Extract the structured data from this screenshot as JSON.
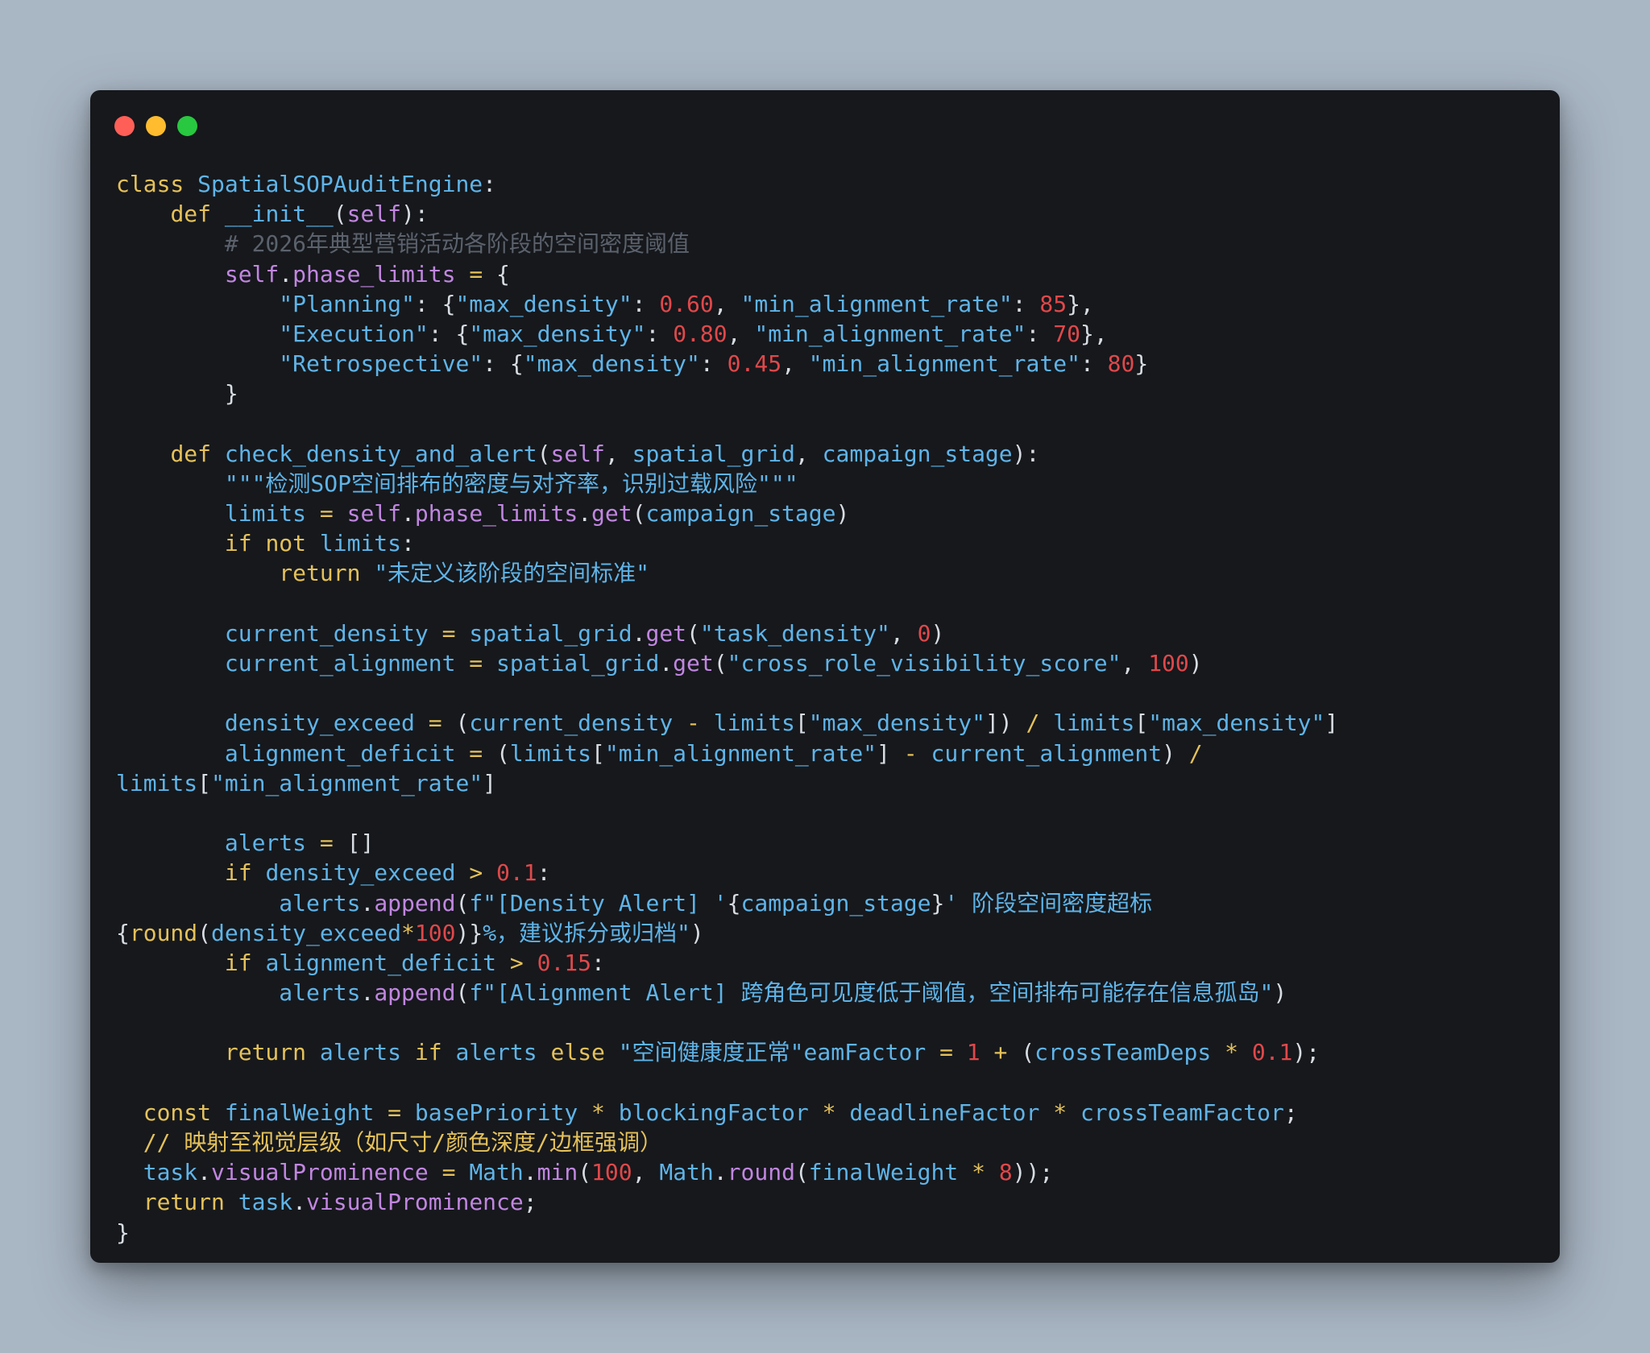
{
  "window": {
    "controls": [
      {
        "name": "close",
        "color": "#ff5f57"
      },
      {
        "name": "minimize",
        "color": "#febc2e"
      },
      {
        "name": "maximize",
        "color": "#28c840"
      }
    ]
  },
  "colors": {
    "background": "#a9b6c4",
    "editor_bg": "#16181c",
    "keyword": "#e5c15a",
    "identifier": "#5fb4e8",
    "self": "#c186e0",
    "number": "#e0484a",
    "comment": "#5b626c",
    "punctuation": "#d8dde3"
  },
  "code_lines": [
    [
      [
        "kw",
        "class"
      ],
      [
        "pun",
        " "
      ],
      [
        "cls",
        "SpatialSOPAuditEngine"
      ],
      [
        "pun",
        ":"
      ]
    ],
    [
      [
        "pun",
        "    "
      ],
      [
        "kw",
        "def"
      ],
      [
        "pun",
        " "
      ],
      [
        "fn",
        "__init__"
      ],
      [
        "pun",
        "("
      ],
      [
        "self",
        "self"
      ],
      [
        "pun",
        "):"
      ]
    ],
    [
      [
        "pun",
        "        "
      ],
      [
        "cm",
        "# 2026年典型营销活动各阶段的空间密度阈值"
      ]
    ],
    [
      [
        "pun",
        "        "
      ],
      [
        "self",
        "self"
      ],
      [
        "pun",
        "."
      ],
      [
        "attr",
        "phase_limits"
      ],
      [
        "pun",
        " "
      ],
      [
        "op",
        "="
      ],
      [
        "pun",
        " {"
      ]
    ],
    [
      [
        "pun",
        "            "
      ],
      [
        "str",
        "\"Planning\""
      ],
      [
        "pun",
        ": {"
      ],
      [
        "str",
        "\"max_density\""
      ],
      [
        "pun",
        ": "
      ],
      [
        "num",
        "0.60"
      ],
      [
        "pun",
        ", "
      ],
      [
        "str",
        "\"min_alignment_rate\""
      ],
      [
        "pun",
        ": "
      ],
      [
        "num",
        "85"
      ],
      [
        "pun",
        "},"
      ]
    ],
    [
      [
        "pun",
        "            "
      ],
      [
        "str",
        "\"Execution\""
      ],
      [
        "pun",
        ": {"
      ],
      [
        "str",
        "\"max_density\""
      ],
      [
        "pun",
        ": "
      ],
      [
        "num",
        "0.80"
      ],
      [
        "pun",
        ", "
      ],
      [
        "str",
        "\"min_alignment_rate\""
      ],
      [
        "pun",
        ": "
      ],
      [
        "num",
        "70"
      ],
      [
        "pun",
        "},"
      ]
    ],
    [
      [
        "pun",
        "            "
      ],
      [
        "str",
        "\"Retrospective\""
      ],
      [
        "pun",
        ": {"
      ],
      [
        "str",
        "\"max_density\""
      ],
      [
        "pun",
        ": "
      ],
      [
        "num",
        "0.45"
      ],
      [
        "pun",
        ", "
      ],
      [
        "str",
        "\"min_alignment_rate\""
      ],
      [
        "pun",
        ": "
      ],
      [
        "num",
        "80"
      ],
      [
        "pun",
        "}"
      ]
    ],
    [
      [
        "pun",
        "        }"
      ]
    ],
    [],
    [
      [
        "pun",
        "    "
      ],
      [
        "kw",
        "def"
      ],
      [
        "pun",
        " "
      ],
      [
        "fn",
        "check_density_and_alert"
      ],
      [
        "pun",
        "("
      ],
      [
        "self",
        "self"
      ],
      [
        "pun",
        ", "
      ],
      [
        "id",
        "spatial_grid"
      ],
      [
        "pun",
        ", "
      ],
      [
        "id",
        "campaign_stage"
      ],
      [
        "pun",
        "):"
      ]
    ],
    [
      [
        "pun",
        "        "
      ],
      [
        "str",
        "\"\"\"检测SOP空间排布的密度与对齐率，识别过载风险\"\"\""
      ]
    ],
    [
      [
        "pun",
        "        "
      ],
      [
        "id",
        "limits"
      ],
      [
        "pun",
        " "
      ],
      [
        "op",
        "="
      ],
      [
        "pun",
        " "
      ],
      [
        "self",
        "self"
      ],
      [
        "pun",
        "."
      ],
      [
        "attr",
        "phase_limits"
      ],
      [
        "pun",
        "."
      ],
      [
        "attr",
        "get"
      ],
      [
        "pun",
        "("
      ],
      [
        "id",
        "campaign_stage"
      ],
      [
        "pun",
        ")"
      ]
    ],
    [
      [
        "pun",
        "        "
      ],
      [
        "kw",
        "if"
      ],
      [
        "pun",
        " "
      ],
      [
        "kw",
        "not"
      ],
      [
        "pun",
        " "
      ],
      [
        "id",
        "limits"
      ],
      [
        "pun",
        ":"
      ]
    ],
    [
      [
        "pun",
        "            "
      ],
      [
        "kw",
        "return"
      ],
      [
        "pun",
        " "
      ],
      [
        "str",
        "\"未定义该阶段的空间标准\""
      ]
    ],
    [],
    [
      [
        "pun",
        "        "
      ],
      [
        "id",
        "current_density"
      ],
      [
        "pun",
        " "
      ],
      [
        "op",
        "="
      ],
      [
        "pun",
        " "
      ],
      [
        "id",
        "spatial_grid"
      ],
      [
        "pun",
        "."
      ],
      [
        "attr",
        "get"
      ],
      [
        "pun",
        "("
      ],
      [
        "str",
        "\"task_density\""
      ],
      [
        "pun",
        ", "
      ],
      [
        "num",
        "0"
      ],
      [
        "pun",
        ")"
      ]
    ],
    [
      [
        "pun",
        "        "
      ],
      [
        "id",
        "current_alignment"
      ],
      [
        "pun",
        " "
      ],
      [
        "op",
        "="
      ],
      [
        "pun",
        " "
      ],
      [
        "id",
        "spatial_grid"
      ],
      [
        "pun",
        "."
      ],
      [
        "attr",
        "get"
      ],
      [
        "pun",
        "("
      ],
      [
        "str",
        "\"cross_role_visibility_score\""
      ],
      [
        "pun",
        ", "
      ],
      [
        "num",
        "100"
      ],
      [
        "pun",
        ")"
      ]
    ],
    [],
    [
      [
        "pun",
        "        "
      ],
      [
        "id",
        "density_exceed"
      ],
      [
        "pun",
        " "
      ],
      [
        "op",
        "="
      ],
      [
        "pun",
        " ("
      ],
      [
        "id",
        "current_density"
      ],
      [
        "pun",
        " "
      ],
      [
        "op",
        "-"
      ],
      [
        "pun",
        " "
      ],
      [
        "id",
        "limits"
      ],
      [
        "pun",
        "["
      ],
      [
        "str",
        "\"max_density\""
      ],
      [
        "pun",
        "]) "
      ],
      [
        "op",
        "/"
      ],
      [
        "pun",
        " "
      ],
      [
        "id",
        "limits"
      ],
      [
        "pun",
        "["
      ],
      [
        "str",
        "\"max_density\""
      ],
      [
        "pun",
        "]"
      ]
    ],
    [
      [
        "pun",
        "        "
      ],
      [
        "id",
        "alignment_deficit"
      ],
      [
        "pun",
        " "
      ],
      [
        "op",
        "="
      ],
      [
        "pun",
        " ("
      ],
      [
        "id",
        "limits"
      ],
      [
        "pun",
        "["
      ],
      [
        "str",
        "\"min_alignment_rate\""
      ],
      [
        "pun",
        "] "
      ],
      [
        "op",
        "-"
      ],
      [
        "pun",
        " "
      ],
      [
        "id",
        "current_alignment"
      ],
      [
        "pun",
        ") "
      ],
      [
        "op",
        "/"
      ]
    ],
    [
      [
        "id",
        "limits"
      ],
      [
        "pun",
        "["
      ],
      [
        "str",
        "\"min_alignment_rate\""
      ],
      [
        "pun",
        "]"
      ]
    ],
    [],
    [
      [
        "pun",
        "        "
      ],
      [
        "id",
        "alerts"
      ],
      [
        "pun",
        " "
      ],
      [
        "op",
        "="
      ],
      [
        "pun",
        " []"
      ]
    ],
    [
      [
        "pun",
        "        "
      ],
      [
        "kw",
        "if"
      ],
      [
        "pun",
        " "
      ],
      [
        "id",
        "density_exceed"
      ],
      [
        "pun",
        " "
      ],
      [
        "op",
        ">"
      ],
      [
        "pun",
        " "
      ],
      [
        "num",
        "0.1"
      ],
      [
        "pun",
        ":"
      ]
    ],
    [
      [
        "pun",
        "            "
      ],
      [
        "id",
        "alerts"
      ],
      [
        "pun",
        "."
      ],
      [
        "attr",
        "append"
      ],
      [
        "pun",
        "("
      ],
      [
        "str",
        "f\"[Density Alert] '"
      ],
      [
        "pun",
        "{"
      ],
      [
        "id",
        "campaign_stage"
      ],
      [
        "pun",
        "}"
      ],
      [
        "str",
        "' 阶段空间密度超标"
      ]
    ],
    [
      [
        "pun",
        "{"
      ],
      [
        "builtin",
        "round"
      ],
      [
        "pun",
        "("
      ],
      [
        "id",
        "density_exceed"
      ],
      [
        "op",
        "*"
      ],
      [
        "num",
        "100"
      ],
      [
        "pun",
        ")}"
      ],
      [
        "str",
        "%，建议拆分或归档\""
      ],
      [
        "pun",
        ")"
      ]
    ],
    [
      [
        "pun",
        "        "
      ],
      [
        "kw",
        "if"
      ],
      [
        "pun",
        " "
      ],
      [
        "id",
        "alignment_deficit"
      ],
      [
        "pun",
        " "
      ],
      [
        "op",
        ">"
      ],
      [
        "pun",
        " "
      ],
      [
        "num",
        "0.15"
      ],
      [
        "pun",
        ":"
      ]
    ],
    [
      [
        "pun",
        "            "
      ],
      [
        "id",
        "alerts"
      ],
      [
        "pun",
        "."
      ],
      [
        "attr",
        "append"
      ],
      [
        "pun",
        "("
      ],
      [
        "str",
        "f\"[Alignment Alert] 跨角色可见度低于阈值，空间排布可能存在信息孤岛\""
      ],
      [
        "pun",
        ")"
      ]
    ],
    [],
    [
      [
        "pun",
        "        "
      ],
      [
        "kw",
        "return"
      ],
      [
        "pun",
        " "
      ],
      [
        "id",
        "alerts"
      ],
      [
        "pun",
        " "
      ],
      [
        "kw",
        "if"
      ],
      [
        "pun",
        " "
      ],
      [
        "id",
        "alerts"
      ],
      [
        "pun",
        " "
      ],
      [
        "kw",
        "else"
      ],
      [
        "pun",
        " "
      ],
      [
        "str",
        "\"空间健康度正常\"eamFactor"
      ],
      [
        "pun",
        " "
      ],
      [
        "op",
        "="
      ],
      [
        "pun",
        " "
      ],
      [
        "num",
        "1"
      ],
      [
        "pun",
        " "
      ],
      [
        "op",
        "+"
      ],
      [
        "pun",
        " ("
      ],
      [
        "id",
        "crossTeamDeps"
      ],
      [
        "pun",
        " "
      ],
      [
        "op",
        "*"
      ],
      [
        "pun",
        " "
      ],
      [
        "num",
        "0.1"
      ],
      [
        "pun",
        ");"
      ]
    ],
    [],
    [
      [
        "pun",
        "  "
      ],
      [
        "kw",
        "const"
      ],
      [
        "pun",
        " "
      ],
      [
        "id",
        "finalWeight"
      ],
      [
        "pun",
        " "
      ],
      [
        "op",
        "="
      ],
      [
        "pun",
        " "
      ],
      [
        "id",
        "basePriority"
      ],
      [
        "pun",
        " "
      ],
      [
        "op",
        "*"
      ],
      [
        "pun",
        " "
      ],
      [
        "id",
        "blockingFactor"
      ],
      [
        "pun",
        " "
      ],
      [
        "op",
        "*"
      ],
      [
        "pun",
        " "
      ],
      [
        "id",
        "deadlineFactor"
      ],
      [
        "pun",
        " "
      ],
      [
        "op",
        "*"
      ],
      [
        "pun",
        " "
      ],
      [
        "id",
        "crossTeamFactor"
      ],
      [
        "pun",
        ";"
      ]
    ],
    [
      [
        "pun",
        "  "
      ],
      [
        "cmt2",
        "// 映射至视觉层级（如尺寸/颜色深度/边框强调）"
      ]
    ],
    [
      [
        "pun",
        "  "
      ],
      [
        "id",
        "task"
      ],
      [
        "pun",
        "."
      ],
      [
        "attr",
        "visualProminence"
      ],
      [
        "pun",
        " "
      ],
      [
        "op",
        "="
      ],
      [
        "pun",
        " "
      ],
      [
        "id",
        "Math"
      ],
      [
        "pun",
        "."
      ],
      [
        "attr",
        "min"
      ],
      [
        "pun",
        "("
      ],
      [
        "num",
        "100"
      ],
      [
        "pun",
        ", "
      ],
      [
        "id",
        "Math"
      ],
      [
        "pun",
        "."
      ],
      [
        "attr",
        "round"
      ],
      [
        "pun",
        "("
      ],
      [
        "id",
        "finalWeight"
      ],
      [
        "pun",
        " "
      ],
      [
        "op",
        "*"
      ],
      [
        "pun",
        " "
      ],
      [
        "num",
        "8"
      ],
      [
        "pun",
        "));"
      ]
    ],
    [
      [
        "pun",
        "  "
      ],
      [
        "kw",
        "return"
      ],
      [
        "pun",
        " "
      ],
      [
        "id",
        "task"
      ],
      [
        "pun",
        "."
      ],
      [
        "attr",
        "visualProminence"
      ],
      [
        "pun",
        ";"
      ]
    ],
    [
      [
        "pun",
        "}"
      ]
    ]
  ]
}
